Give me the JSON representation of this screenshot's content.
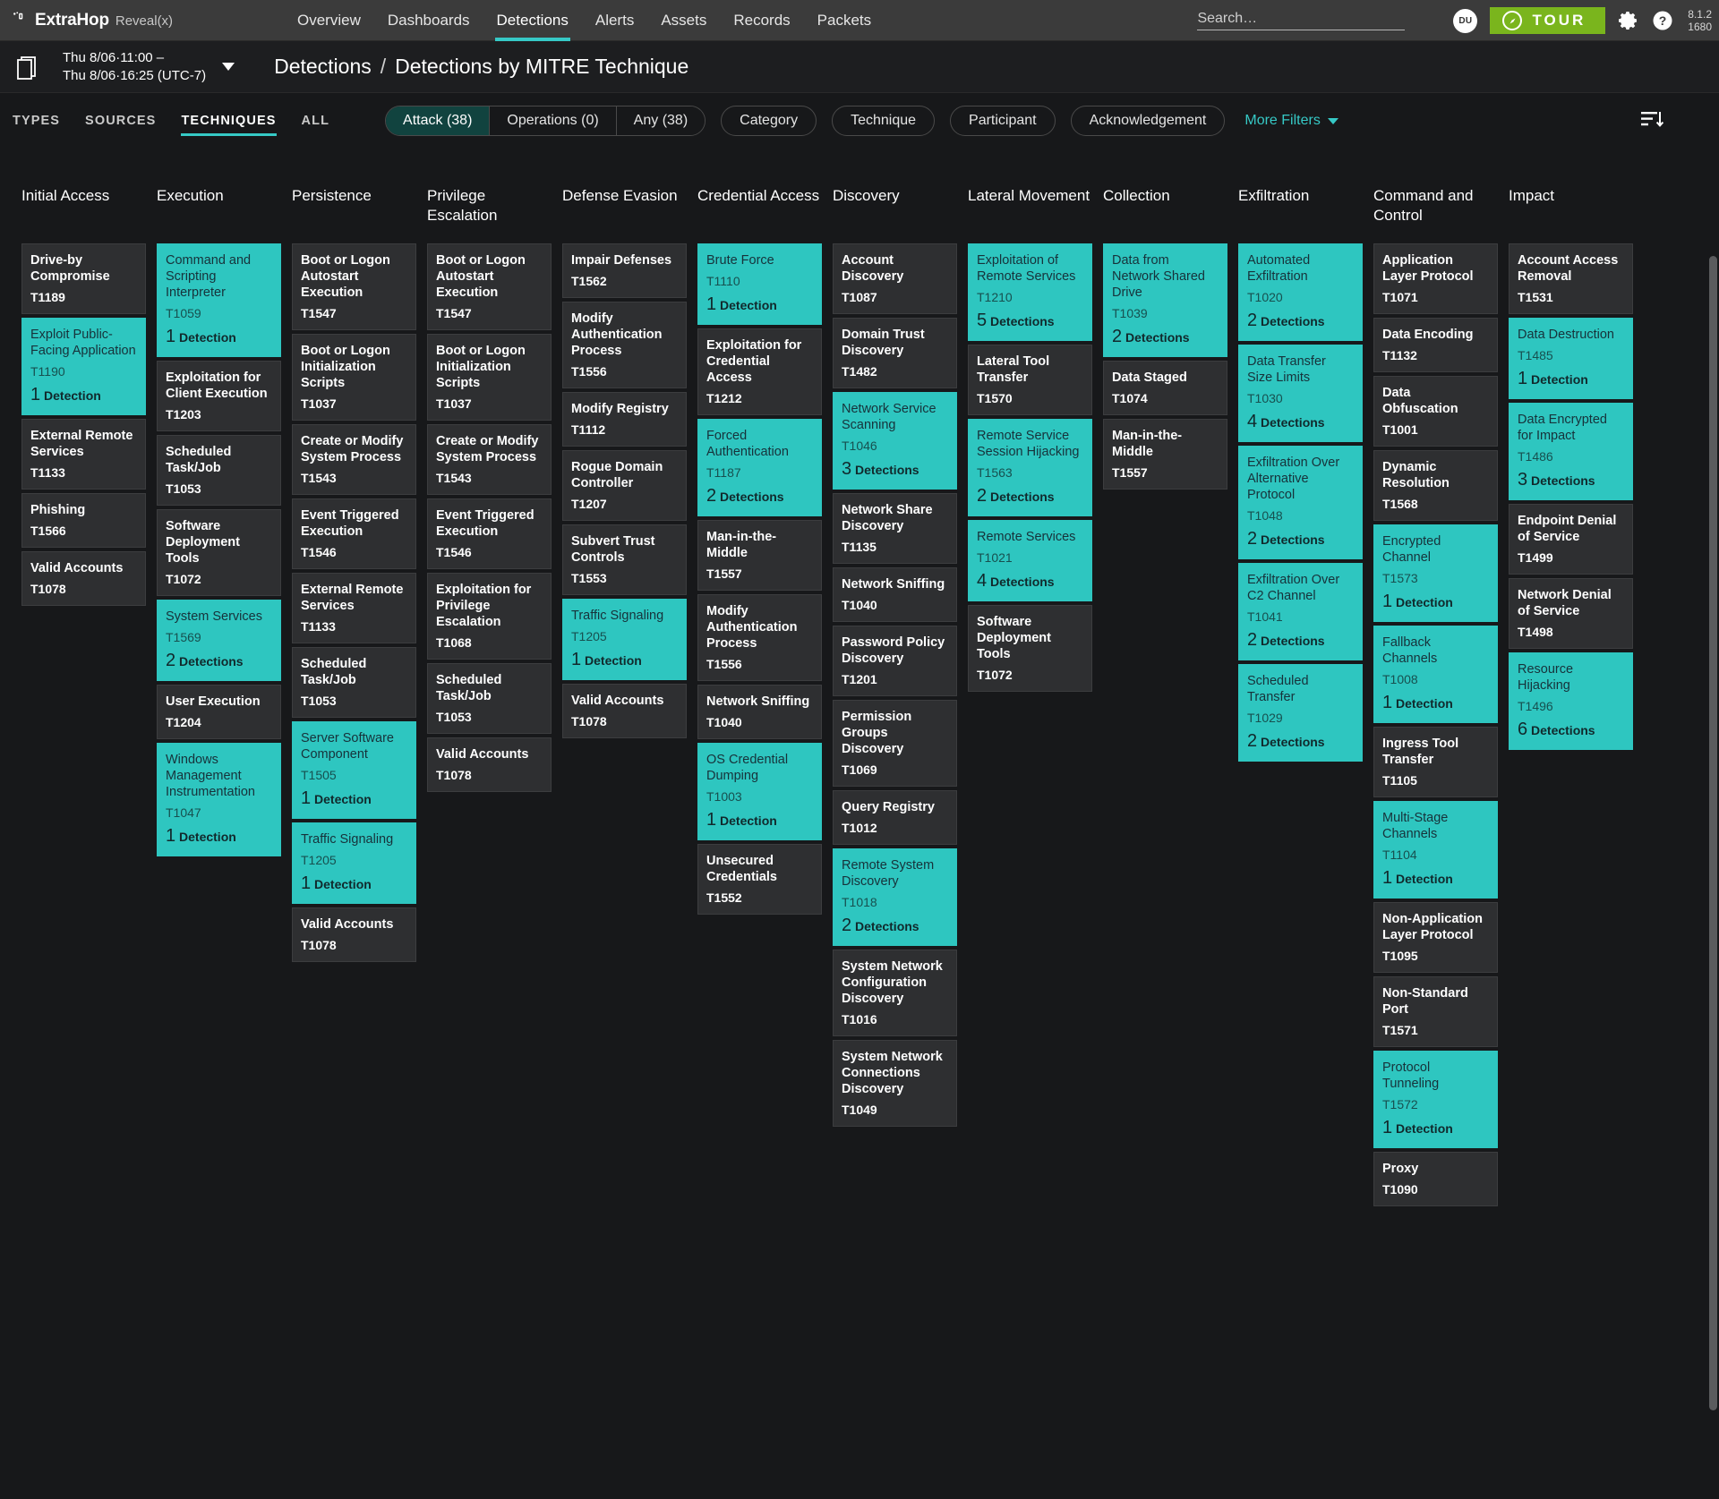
{
  "app": {
    "brand_name": "ExtraHop",
    "brand_sub": "Reveal(x)",
    "version_line1": "8.1.2",
    "version_line2": "1680"
  },
  "topnav": {
    "items": [
      {
        "label": "Overview",
        "active": false
      },
      {
        "label": "Dashboards",
        "active": false
      },
      {
        "label": "Detections",
        "active": true
      },
      {
        "label": "Alerts",
        "active": false
      },
      {
        "label": "Assets",
        "active": false
      },
      {
        "label": "Records",
        "active": false
      },
      {
        "label": "Packets",
        "active": false
      }
    ],
    "search_placeholder": "Search…",
    "avatar_initials": "DU",
    "tour_label": "TOUR"
  },
  "crumbbar": {
    "time_range": "Thu 8/06·11:00 –\nThu 8/06·16:25 (UTC-7)",
    "crumb_root": "Detections",
    "crumb_sep": "/",
    "crumb_current": "Detections by MITRE Technique"
  },
  "filterbar": {
    "subtabs": [
      {
        "label": "TYPES",
        "active": false
      },
      {
        "label": "SOURCES",
        "active": false
      },
      {
        "label": "TECHNIQUES",
        "active": true
      },
      {
        "label": "ALL",
        "active": false
      }
    ],
    "segments": [
      {
        "label": "Attack (38)",
        "active": true
      },
      {
        "label": "Operations (0)",
        "active": false
      },
      {
        "label": "Any (38)",
        "active": false
      }
    ],
    "pills": [
      "Category",
      "Technique",
      "Participant",
      "Acknowledgement"
    ],
    "more_filters": "More Filters"
  },
  "matrix": {
    "detection_singular": "Detection",
    "detection_plural": "Detections",
    "columns": [
      {
        "title": "Initial Access",
        "cells": [
          {
            "name": "Drive-by Compromise",
            "id": "T1189",
            "detections": 0
          },
          {
            "name": "Exploit Public-Facing Application",
            "id": "T1190",
            "detections": 1
          },
          {
            "name": "External Remote Services",
            "id": "T1133",
            "detections": 0
          },
          {
            "name": "Phishing",
            "id": "T1566",
            "detections": 0
          },
          {
            "name": "Valid Accounts",
            "id": "T1078",
            "detections": 0
          }
        ]
      },
      {
        "title": "Execution",
        "cells": [
          {
            "name": "Command and Scripting Interpreter",
            "id": "T1059",
            "detections": 1
          },
          {
            "name": "Exploitation for Client Execution",
            "id": "T1203",
            "detections": 0
          },
          {
            "name": "Scheduled Task/Job",
            "id": "T1053",
            "detections": 0
          },
          {
            "name": "Software Deployment Tools",
            "id": "T1072",
            "detections": 0
          },
          {
            "name": "System Services",
            "id": "T1569",
            "detections": 2
          },
          {
            "name": "User Execution",
            "id": "T1204",
            "detections": 0
          },
          {
            "name": "Windows Management Instrumentation",
            "id": "T1047",
            "detections": 1
          }
        ]
      },
      {
        "title": "Persistence",
        "cells": [
          {
            "name": "Boot or Logon Autostart Execution",
            "id": "T1547",
            "detections": 0
          },
          {
            "name": "Boot or Logon Initialization Scripts",
            "id": "T1037",
            "detections": 0
          },
          {
            "name": "Create or Modify System Process",
            "id": "T1543",
            "detections": 0
          },
          {
            "name": "Event Triggered Execution",
            "id": "T1546",
            "detections": 0
          },
          {
            "name": "External Remote Services",
            "id": "T1133",
            "detections": 0
          },
          {
            "name": "Scheduled Task/Job",
            "id": "T1053",
            "detections": 0
          },
          {
            "name": "Server Software Component",
            "id": "T1505",
            "detections": 1
          },
          {
            "name": "Traffic Signaling",
            "id": "T1205",
            "detections": 1
          },
          {
            "name": "Valid Accounts",
            "id": "T1078",
            "detections": 0
          }
        ]
      },
      {
        "title": "Privilege Escalation",
        "cells": [
          {
            "name": "Boot or Logon Autostart Execution",
            "id": "T1547",
            "detections": 0
          },
          {
            "name": "Boot or Logon Initialization Scripts",
            "id": "T1037",
            "detections": 0
          },
          {
            "name": "Create or Modify System Process",
            "id": "T1543",
            "detections": 0
          },
          {
            "name": "Event Triggered Execution",
            "id": "T1546",
            "detections": 0
          },
          {
            "name": "Exploitation for Privilege Escalation",
            "id": "T1068",
            "detections": 0
          },
          {
            "name": "Scheduled Task/Job",
            "id": "T1053",
            "detections": 0
          },
          {
            "name": "Valid Accounts",
            "id": "T1078",
            "detections": 0
          }
        ]
      },
      {
        "title": "Defense Evasion",
        "cells": [
          {
            "name": "Impair Defenses",
            "id": "T1562",
            "detections": 0
          },
          {
            "name": "Modify Authentication Process",
            "id": "T1556",
            "detections": 0
          },
          {
            "name": "Modify Registry",
            "id": "T1112",
            "detections": 0
          },
          {
            "name": "Rogue Domain Controller",
            "id": "T1207",
            "detections": 0
          },
          {
            "name": "Subvert Trust Controls",
            "id": "T1553",
            "detections": 0
          },
          {
            "name": "Traffic Signaling",
            "id": "T1205",
            "detections": 1
          },
          {
            "name": "Valid Accounts",
            "id": "T1078",
            "detections": 0
          }
        ]
      },
      {
        "title": "Credential Access",
        "cells": [
          {
            "name": "Brute Force",
            "id": "T1110",
            "detections": 1
          },
          {
            "name": "Exploitation for Credential Access",
            "id": "T1212",
            "detections": 0
          },
          {
            "name": "Forced Authentication",
            "id": "T1187",
            "detections": 2
          },
          {
            "name": "Man-in-the-Middle",
            "id": "T1557",
            "detections": 0
          },
          {
            "name": "Modify Authentication Process",
            "id": "T1556",
            "detections": 0
          },
          {
            "name": "Network Sniffing",
            "id": "T1040",
            "detections": 0
          },
          {
            "name": "OS Credential Dumping",
            "id": "T1003",
            "detections": 1
          },
          {
            "name": "Unsecured Credentials",
            "id": "T1552",
            "detections": 0
          }
        ]
      },
      {
        "title": "Discovery",
        "cells": [
          {
            "name": "Account Discovery",
            "id": "T1087",
            "detections": 0
          },
          {
            "name": "Domain Trust Discovery",
            "id": "T1482",
            "detections": 0
          },
          {
            "name": "Network Service Scanning",
            "id": "T1046",
            "detections": 3
          },
          {
            "name": "Network Share Discovery",
            "id": "T1135",
            "detections": 0
          },
          {
            "name": "Network Sniffing",
            "id": "T1040",
            "detections": 0
          },
          {
            "name": "Password Policy Discovery",
            "id": "T1201",
            "detections": 0
          },
          {
            "name": "Permission Groups Discovery",
            "id": "T1069",
            "detections": 0
          },
          {
            "name": "Query Registry",
            "id": "T1012",
            "detections": 0
          },
          {
            "name": "Remote System Discovery",
            "id": "T1018",
            "detections": 2
          },
          {
            "name": "System Network Configuration Discovery",
            "id": "T1016",
            "detections": 0
          },
          {
            "name": "System Network Connections Discovery",
            "id": "T1049",
            "detections": 0
          }
        ]
      },
      {
        "title": "Lateral Movement",
        "cells": [
          {
            "name": "Exploitation of Remote Services",
            "id": "T1210",
            "detections": 5
          },
          {
            "name": "Lateral Tool Transfer",
            "id": "T1570",
            "detections": 0
          },
          {
            "name": "Remote Service Session Hijacking",
            "id": "T1563",
            "detections": 2
          },
          {
            "name": "Remote Services",
            "id": "T1021",
            "detections": 4
          },
          {
            "name": "Software Deployment Tools",
            "id": "T1072",
            "detections": 0
          }
        ]
      },
      {
        "title": "Collection",
        "cells": [
          {
            "name": "Data from Network Shared Drive",
            "id": "T1039",
            "detections": 2
          },
          {
            "name": "Data Staged",
            "id": "T1074",
            "detections": 0
          },
          {
            "name": "Man-in-the-Middle",
            "id": "T1557",
            "detections": 0
          }
        ]
      },
      {
        "title": "Exfiltration",
        "cells": [
          {
            "name": "Automated Exfiltration",
            "id": "T1020",
            "detections": 2
          },
          {
            "name": "Data Transfer Size Limits",
            "id": "T1030",
            "detections": 4
          },
          {
            "name": "Exfiltration Over Alternative Protocol",
            "id": "T1048",
            "detections": 2
          },
          {
            "name": "Exfiltration Over C2 Channel",
            "id": "T1041",
            "detections": 2
          },
          {
            "name": "Scheduled Transfer",
            "id": "T1029",
            "detections": 2
          }
        ]
      },
      {
        "title": "Command and Control",
        "cells": [
          {
            "name": "Application Layer Protocol",
            "id": "T1071",
            "detections": 0
          },
          {
            "name": "Data Encoding",
            "id": "T1132",
            "detections": 0
          },
          {
            "name": "Data Obfuscation",
            "id": "T1001",
            "detections": 0
          },
          {
            "name": "Dynamic Resolution",
            "id": "T1568",
            "detections": 0
          },
          {
            "name": "Encrypted Channel",
            "id": "T1573",
            "detections": 1
          },
          {
            "name": "Fallback Channels",
            "id": "T1008",
            "detections": 1
          },
          {
            "name": "Ingress Tool Transfer",
            "id": "T1105",
            "detections": 0
          },
          {
            "name": "Multi-Stage Channels",
            "id": "T1104",
            "detections": 1
          },
          {
            "name": "Non-Application Layer Protocol",
            "id": "T1095",
            "detections": 0
          },
          {
            "name": "Non-Standard Port",
            "id": "T1571",
            "detections": 0
          },
          {
            "name": "Protocol Tunneling",
            "id": "T1572",
            "detections": 1
          },
          {
            "name": "Proxy",
            "id": "T1090",
            "detections": 0
          }
        ]
      },
      {
        "title": "Impact",
        "cells": [
          {
            "name": "Account Access Removal",
            "id": "T1531",
            "detections": 0
          },
          {
            "name": "Data Destruction",
            "id": "T1485",
            "detections": 1
          },
          {
            "name": "Data Encrypted for Impact",
            "id": "T1486",
            "detections": 3
          },
          {
            "name": "Endpoint Denial of Service",
            "id": "T1499",
            "detections": 0
          },
          {
            "name": "Network Denial of Service",
            "id": "T1498",
            "detections": 0
          },
          {
            "name": "Resource Hijacking",
            "id": "T1496",
            "detections": 6
          }
        ]
      }
    ]
  },
  "colors": {
    "accent": "#36c9c6",
    "hit": "#2ec6c0",
    "tour": "#7ab51d",
    "page_bg": "#17181a"
  }
}
